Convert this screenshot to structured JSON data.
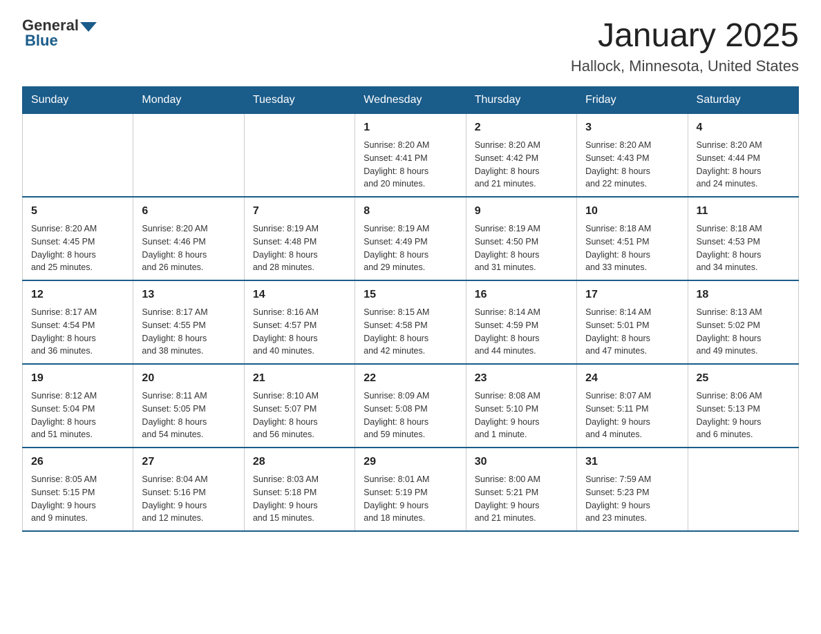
{
  "logo": {
    "general": "General",
    "blue": "Blue"
  },
  "title": "January 2025",
  "subtitle": "Hallock, Minnesota, United States",
  "weekdays": [
    "Sunday",
    "Monday",
    "Tuesday",
    "Wednesday",
    "Thursday",
    "Friday",
    "Saturday"
  ],
  "weeks": [
    [
      {
        "day": "",
        "info": ""
      },
      {
        "day": "",
        "info": ""
      },
      {
        "day": "",
        "info": ""
      },
      {
        "day": "1",
        "info": "Sunrise: 8:20 AM\nSunset: 4:41 PM\nDaylight: 8 hours\nand 20 minutes."
      },
      {
        "day": "2",
        "info": "Sunrise: 8:20 AM\nSunset: 4:42 PM\nDaylight: 8 hours\nand 21 minutes."
      },
      {
        "day": "3",
        "info": "Sunrise: 8:20 AM\nSunset: 4:43 PM\nDaylight: 8 hours\nand 22 minutes."
      },
      {
        "day": "4",
        "info": "Sunrise: 8:20 AM\nSunset: 4:44 PM\nDaylight: 8 hours\nand 24 minutes."
      }
    ],
    [
      {
        "day": "5",
        "info": "Sunrise: 8:20 AM\nSunset: 4:45 PM\nDaylight: 8 hours\nand 25 minutes."
      },
      {
        "day": "6",
        "info": "Sunrise: 8:20 AM\nSunset: 4:46 PM\nDaylight: 8 hours\nand 26 minutes."
      },
      {
        "day": "7",
        "info": "Sunrise: 8:19 AM\nSunset: 4:48 PM\nDaylight: 8 hours\nand 28 minutes."
      },
      {
        "day": "8",
        "info": "Sunrise: 8:19 AM\nSunset: 4:49 PM\nDaylight: 8 hours\nand 29 minutes."
      },
      {
        "day": "9",
        "info": "Sunrise: 8:19 AM\nSunset: 4:50 PM\nDaylight: 8 hours\nand 31 minutes."
      },
      {
        "day": "10",
        "info": "Sunrise: 8:18 AM\nSunset: 4:51 PM\nDaylight: 8 hours\nand 33 minutes."
      },
      {
        "day": "11",
        "info": "Sunrise: 8:18 AM\nSunset: 4:53 PM\nDaylight: 8 hours\nand 34 minutes."
      }
    ],
    [
      {
        "day": "12",
        "info": "Sunrise: 8:17 AM\nSunset: 4:54 PM\nDaylight: 8 hours\nand 36 minutes."
      },
      {
        "day": "13",
        "info": "Sunrise: 8:17 AM\nSunset: 4:55 PM\nDaylight: 8 hours\nand 38 minutes."
      },
      {
        "day": "14",
        "info": "Sunrise: 8:16 AM\nSunset: 4:57 PM\nDaylight: 8 hours\nand 40 minutes."
      },
      {
        "day": "15",
        "info": "Sunrise: 8:15 AM\nSunset: 4:58 PM\nDaylight: 8 hours\nand 42 minutes."
      },
      {
        "day": "16",
        "info": "Sunrise: 8:14 AM\nSunset: 4:59 PM\nDaylight: 8 hours\nand 44 minutes."
      },
      {
        "day": "17",
        "info": "Sunrise: 8:14 AM\nSunset: 5:01 PM\nDaylight: 8 hours\nand 47 minutes."
      },
      {
        "day": "18",
        "info": "Sunrise: 8:13 AM\nSunset: 5:02 PM\nDaylight: 8 hours\nand 49 minutes."
      }
    ],
    [
      {
        "day": "19",
        "info": "Sunrise: 8:12 AM\nSunset: 5:04 PM\nDaylight: 8 hours\nand 51 minutes."
      },
      {
        "day": "20",
        "info": "Sunrise: 8:11 AM\nSunset: 5:05 PM\nDaylight: 8 hours\nand 54 minutes."
      },
      {
        "day": "21",
        "info": "Sunrise: 8:10 AM\nSunset: 5:07 PM\nDaylight: 8 hours\nand 56 minutes."
      },
      {
        "day": "22",
        "info": "Sunrise: 8:09 AM\nSunset: 5:08 PM\nDaylight: 8 hours\nand 59 minutes."
      },
      {
        "day": "23",
        "info": "Sunrise: 8:08 AM\nSunset: 5:10 PM\nDaylight: 9 hours\nand 1 minute."
      },
      {
        "day": "24",
        "info": "Sunrise: 8:07 AM\nSunset: 5:11 PM\nDaylight: 9 hours\nand 4 minutes."
      },
      {
        "day": "25",
        "info": "Sunrise: 8:06 AM\nSunset: 5:13 PM\nDaylight: 9 hours\nand 6 minutes."
      }
    ],
    [
      {
        "day": "26",
        "info": "Sunrise: 8:05 AM\nSunset: 5:15 PM\nDaylight: 9 hours\nand 9 minutes."
      },
      {
        "day": "27",
        "info": "Sunrise: 8:04 AM\nSunset: 5:16 PM\nDaylight: 9 hours\nand 12 minutes."
      },
      {
        "day": "28",
        "info": "Sunrise: 8:03 AM\nSunset: 5:18 PM\nDaylight: 9 hours\nand 15 minutes."
      },
      {
        "day": "29",
        "info": "Sunrise: 8:01 AM\nSunset: 5:19 PM\nDaylight: 9 hours\nand 18 minutes."
      },
      {
        "day": "30",
        "info": "Sunrise: 8:00 AM\nSunset: 5:21 PM\nDaylight: 9 hours\nand 21 minutes."
      },
      {
        "day": "31",
        "info": "Sunrise: 7:59 AM\nSunset: 5:23 PM\nDaylight: 9 hours\nand 23 minutes."
      },
      {
        "day": "",
        "info": ""
      }
    ]
  ]
}
